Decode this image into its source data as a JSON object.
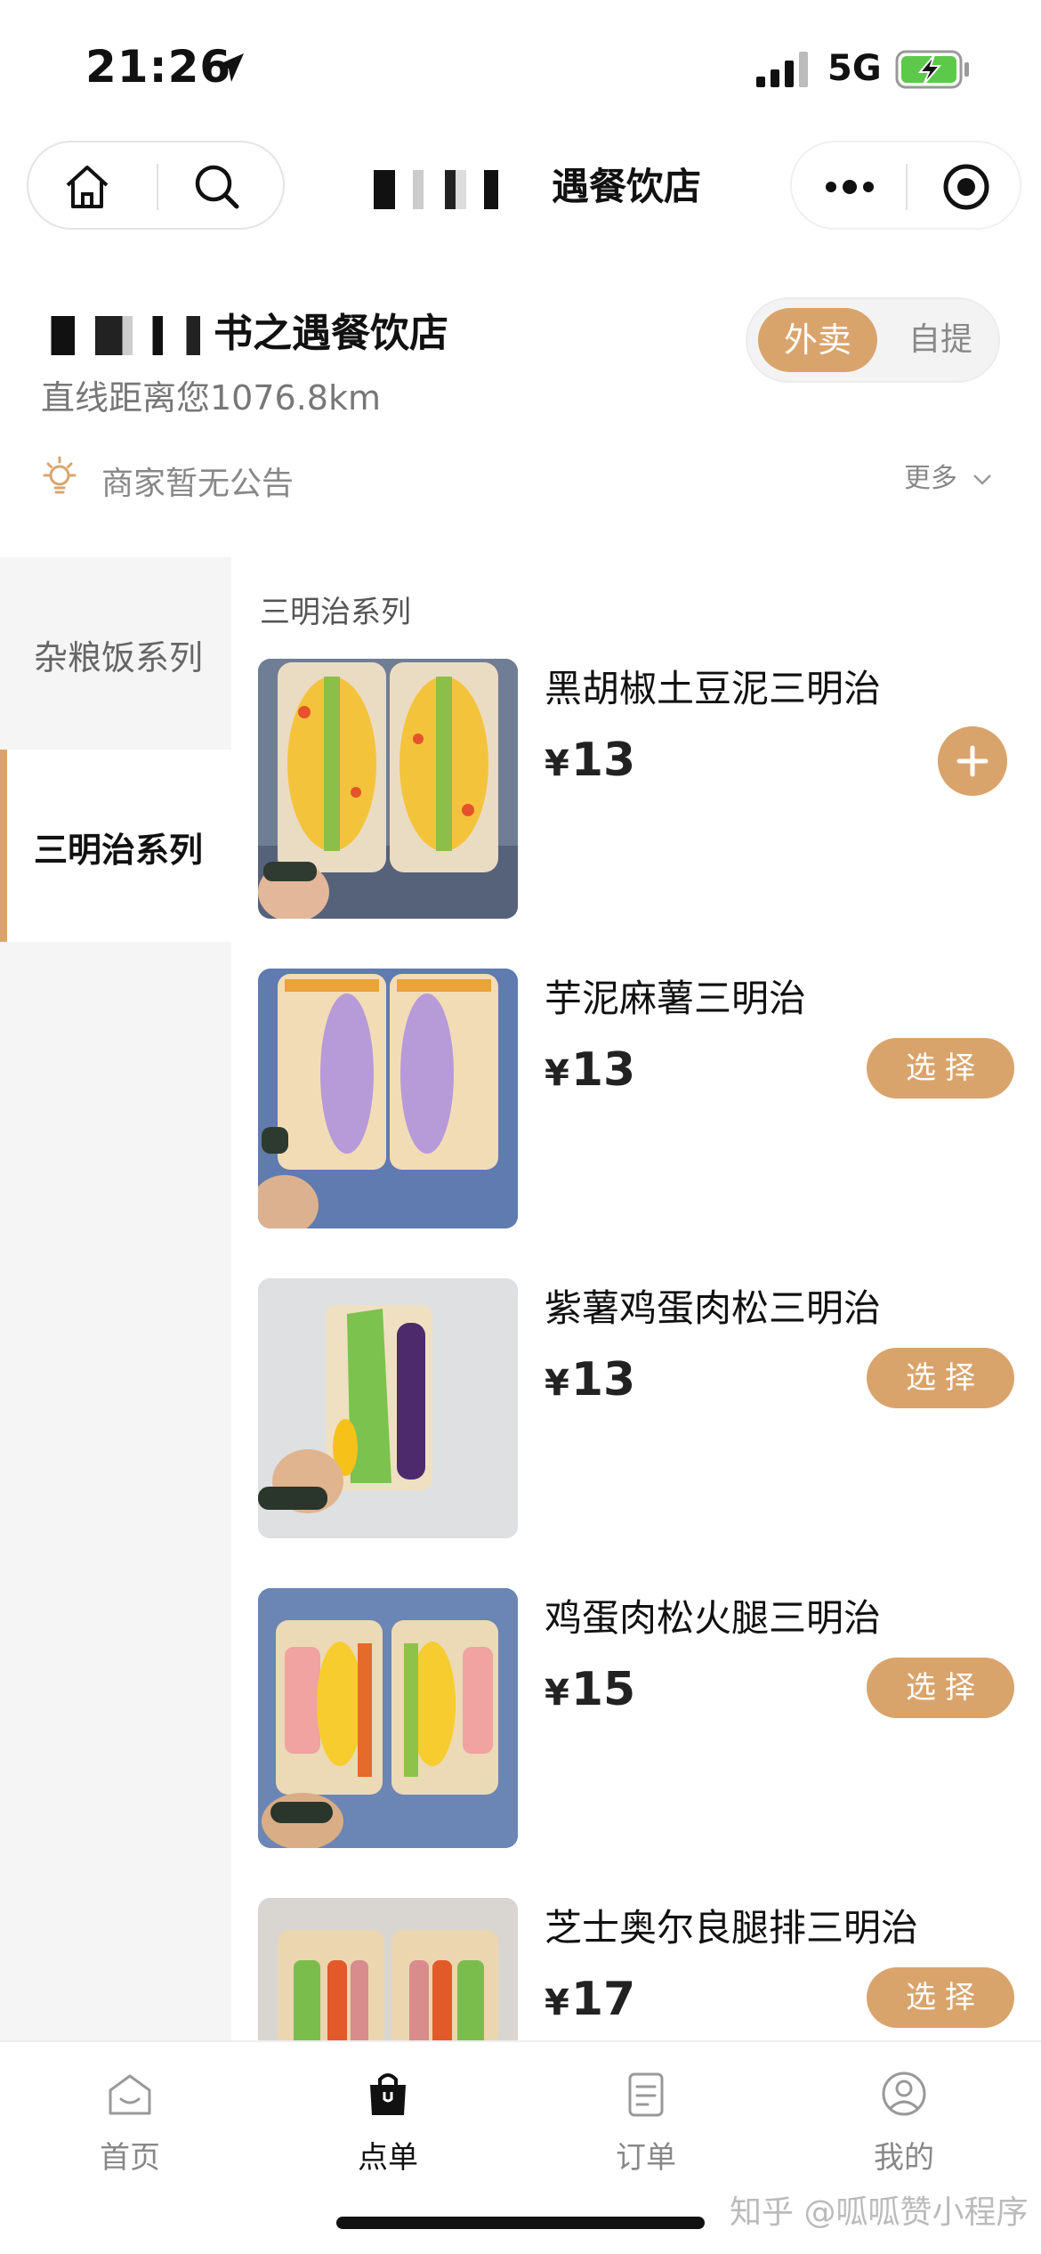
{
  "status_bar": {
    "time": "21:26",
    "network": "5G"
  },
  "nav": {
    "title_suffix": "遇餐饮店"
  },
  "store": {
    "name_suffix": "书之遇餐饮店",
    "distance": "直线距离您1076.8km",
    "notice": "商家暂无公告",
    "notice_more": "更多"
  },
  "mode": {
    "active": "外卖",
    "inactive": "自提"
  },
  "categories": [
    {
      "label": "杂粮饭系列",
      "active": false
    },
    {
      "label": "三明治系列",
      "active": true
    }
  ],
  "section_title": "三明治系列",
  "products": [
    {
      "name": "黑胡椒土豆泥三明治",
      "currency": "¥",
      "price": "13",
      "action": "add"
    },
    {
      "name": "芋泥麻薯三明治",
      "currency": "¥",
      "price": "13",
      "action": "选择"
    },
    {
      "name": "紫薯鸡蛋肉松三明治",
      "currency": "¥",
      "price": "13",
      "action": "选择"
    },
    {
      "name": "鸡蛋肉松火腿三明治",
      "currency": "¥",
      "price": "15",
      "action": "选择"
    },
    {
      "name": "芝士奥尔良腿排三明治",
      "currency": "¥",
      "price": "17",
      "action": "选择"
    }
  ],
  "tabs": [
    {
      "label": "首页",
      "icon": "home-smile-icon",
      "active": false
    },
    {
      "label": "点单",
      "icon": "shopping-bag-icon",
      "active": true
    },
    {
      "label": "订单",
      "icon": "order-doc-icon",
      "active": false
    },
    {
      "label": "我的",
      "icon": "user-circle-icon",
      "active": false
    }
  ],
  "watermark": "知乎 @呱呱赞小程序",
  "colors": {
    "accent": "#d9a46c",
    "sidebar_bg": "#f5f5f5",
    "text_muted": "#888888"
  }
}
